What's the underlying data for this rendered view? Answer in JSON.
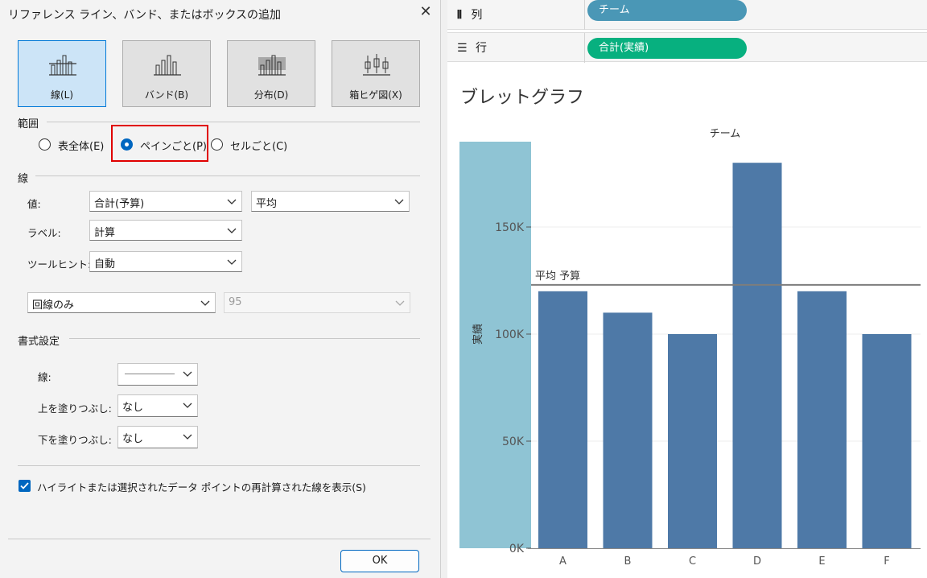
{
  "dialog": {
    "title": "リファレンス ライン、バンド、またはボックスの追加",
    "type_buttons": [
      {
        "label": "線(L)",
        "icon": "line-type-icon",
        "selected": true
      },
      {
        "label": "バンド(B)",
        "icon": "band-type-icon",
        "selected": false
      },
      {
        "label": "分布(D)",
        "icon": "distribution-type-icon",
        "selected": false
      },
      {
        "label": "箱ヒゲ図(X)",
        "icon": "boxplot-type-icon",
        "selected": false
      }
    ],
    "scope": {
      "label": "範囲",
      "options": [
        "表全体(E)",
        "ペインごと(P)",
        "セルごと(C)"
      ],
      "selected": "ペインごと(P)"
    },
    "line_section": {
      "label": "線",
      "value_label": "値:",
      "value_field": "合計(予算)",
      "value_agg": "平均",
      "label_label": "ラベル:",
      "label_value": "計算",
      "tooltip_label": "ツールヒント:",
      "tooltip_value": "自動",
      "ci_mode": "回線のみ",
      "ci_value": "95"
    },
    "format_section": {
      "label": "書式設定",
      "line_label": "線:",
      "fill_above_label": "上を塗りつぶし:",
      "fill_above_value": "なし",
      "fill_below_label": "下を塗りつぶし:",
      "fill_below_value": "なし"
    },
    "checkbox_label": "ハイライトまたは選択されたデータ ポイントの再計算された線を表示(S)",
    "checkbox_checked": true,
    "ok_label": "OK",
    "accent": "#0067c0",
    "highlight": "#e00000"
  },
  "shelves": {
    "columns": {
      "name": "列",
      "pill": "チーム",
      "pill_color": "#4a97b6",
      "icon": "columns-icon"
    },
    "rows": {
      "name": "行",
      "pill": "合計(実績)",
      "pill_color": "#07b07f",
      "icon": "rows-icon"
    }
  },
  "sheet_title": "ブレットグラフ",
  "chart_data": {
    "type": "bar",
    "column_header": "チーム",
    "categories": [
      "A",
      "B",
      "C",
      "D",
      "E",
      "F"
    ],
    "values": [
      120000,
      110000,
      100000,
      180000,
      120000,
      100000
    ],
    "ylabel": "実績",
    "ylim": [
      0,
      190000
    ],
    "yticks": [
      0,
      50000,
      100000,
      150000
    ],
    "ytick_labels": [
      "0K",
      "50K",
      "100K",
      "150K"
    ],
    "reference_line": {
      "value": 123000,
      "label": "平均 予算"
    },
    "bar_color": "#4e79a7",
    "band_color": "#8fc4d4",
    "grid": true
  }
}
